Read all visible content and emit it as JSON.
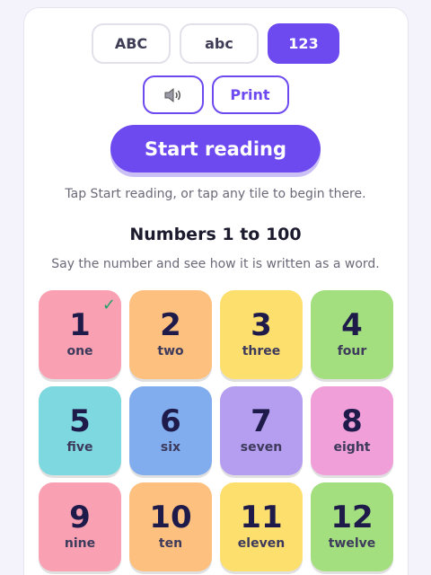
{
  "mode_buttons": [
    {
      "label": "ABC",
      "active": false
    },
    {
      "label": "abc",
      "active": false
    },
    {
      "label": "123",
      "active": true
    }
  ],
  "tools": {
    "sound_icon": "speaker-icon",
    "print_label": "Print"
  },
  "start_label": "Start reading",
  "hint": "Tap Start reading, or tap any tile to begin there.",
  "title": "Numbers 1 to 100",
  "subtitle": "Say the number and see how it is written as a word.",
  "tiles": [
    {
      "num": "1",
      "word": "one",
      "color": "#f9a1b2",
      "checked": true
    },
    {
      "num": "2",
      "word": "two",
      "color": "#fdc07e"
    },
    {
      "num": "3",
      "word": "three",
      "color": "#fddf6e"
    },
    {
      "num": "4",
      "word": "four",
      "color": "#a4df7f"
    },
    {
      "num": "5",
      "word": "five",
      "color": "#7ed8e0"
    },
    {
      "num": "6",
      "word": "six",
      "color": "#81acee"
    },
    {
      "num": "7",
      "word": "seven",
      "color": "#b59ef0"
    },
    {
      "num": "8",
      "word": "eight",
      "color": "#f09fd9"
    },
    {
      "num": "9",
      "word": "nine",
      "color": "#f9a1b2"
    },
    {
      "num": "10",
      "word": "ten",
      "color": "#fdc07e"
    },
    {
      "num": "11",
      "word": "eleven",
      "color": "#fddf6e"
    },
    {
      "num": "12",
      "word": "twelve",
      "color": "#a4df7f"
    }
  ],
  "colors": {
    "accent": "#6d4af0",
    "check": "#22a06b"
  }
}
